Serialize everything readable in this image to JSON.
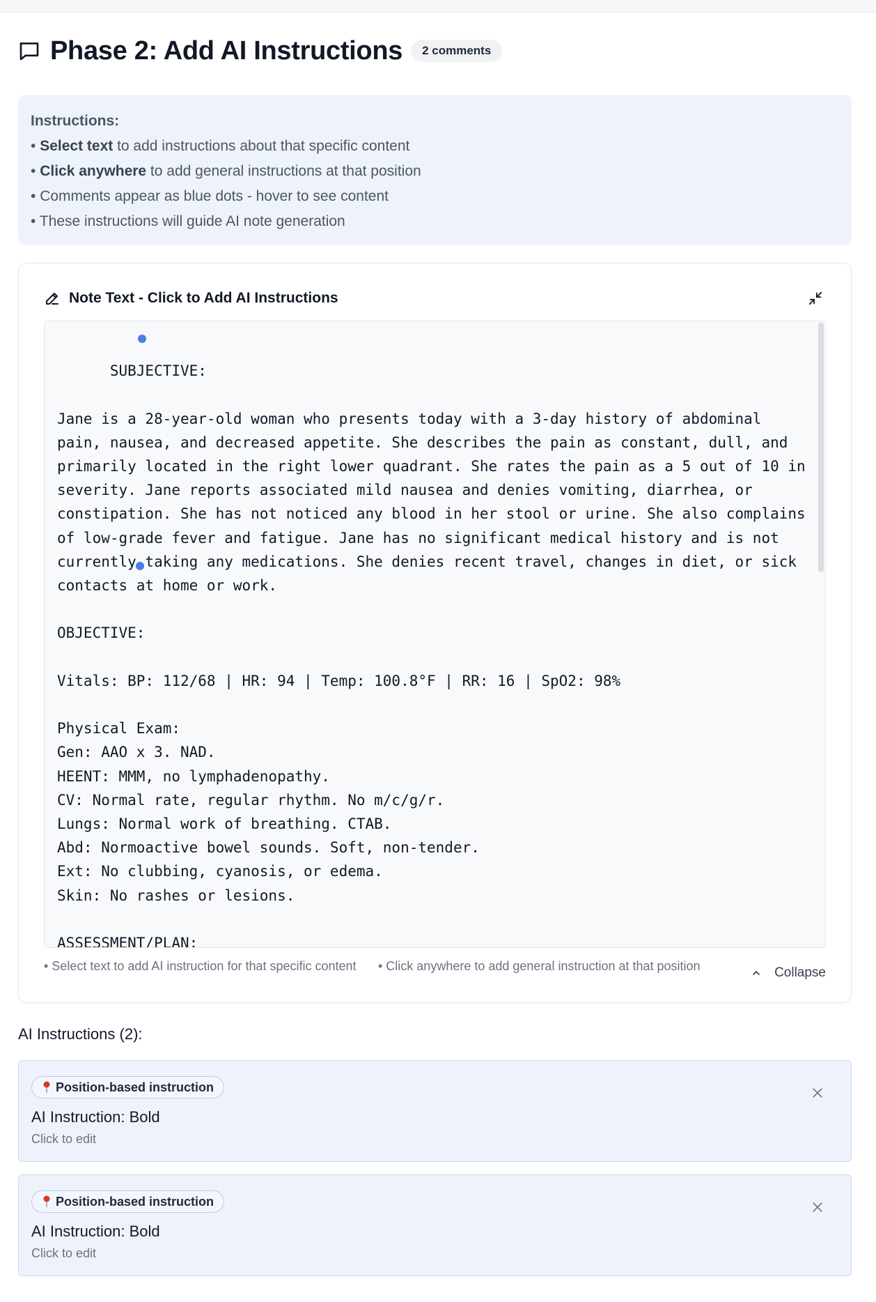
{
  "header": {
    "title": "Phase 2: Add AI Instructions",
    "badge": "2 comments"
  },
  "instructions": {
    "title": "Instructions:",
    "items": [
      {
        "bold": "Select text",
        "rest": " to add instructions about that specific content"
      },
      {
        "bold": "Click anywhere",
        "rest": " to add general instructions at that position"
      },
      {
        "bold": "",
        "rest": "Comments appear as blue dots - hover to see content"
      },
      {
        "bold": "",
        "rest": "These instructions will guide AI note generation"
      }
    ]
  },
  "note": {
    "title": "Note Text - Click to Add AI Instructions",
    "text": "SUBJECTIVE:\n\nJane is a 28-year-old woman who presents today with a 3-day history of abdominal pain, nausea, and decreased appetite. She describes the pain as constant, dull, and primarily located in the right lower quadrant. She rates the pain as a 5 out of 10 in severity. Jane reports associated mild nausea and denies vomiting, diarrhea, or constipation. She has not noticed any blood in her stool or urine. She also complains of low-grade fever and fatigue. Jane has no significant medical history and is not currently taking any medications. She denies recent travel, changes in diet, or sick contacts at home or work.\n\nOBJECTIVE:\n\nVitals: BP: 112/68 | HR: 94 | Temp: 100.8°F | RR: 16 | SpO2: 98%\n\nPhysical Exam:\nGen: AAO x 3. NAD.\nHEENT: MMM, no lymphadenopathy.\nCV: Normal rate, regular rhythm. No m/c/g/r.\nLungs: Normal work of breathing. CTAB.\nAbd: Normoactive bowel sounds. Soft, non-tender.\nExt: No clubbing, cyanosis, or edema.\nSkin: No rashes or lesions.\n\nASSESSMENT/PLAN:",
    "hint_select": "• Select text to add AI instruction for that specific content",
    "hint_click": "• Click anywhere to add general instruction at that position",
    "collapse_label": "Collapse"
  },
  "ai_instructions": {
    "heading": "AI Instructions (2):",
    "items": [
      {
        "chip": "Position-based instruction",
        "label": "AI Instruction:",
        "value": " Bold",
        "edit": "Click to edit"
      },
      {
        "chip": "Position-based instruction",
        "label": "AI Instruction:",
        "value": " Bold",
        "edit": "Click to edit"
      }
    ]
  },
  "colors": {
    "accent_dot": "#4a7ee6",
    "card_bg": "#eef3fb",
    "pin": "#e0352b"
  }
}
